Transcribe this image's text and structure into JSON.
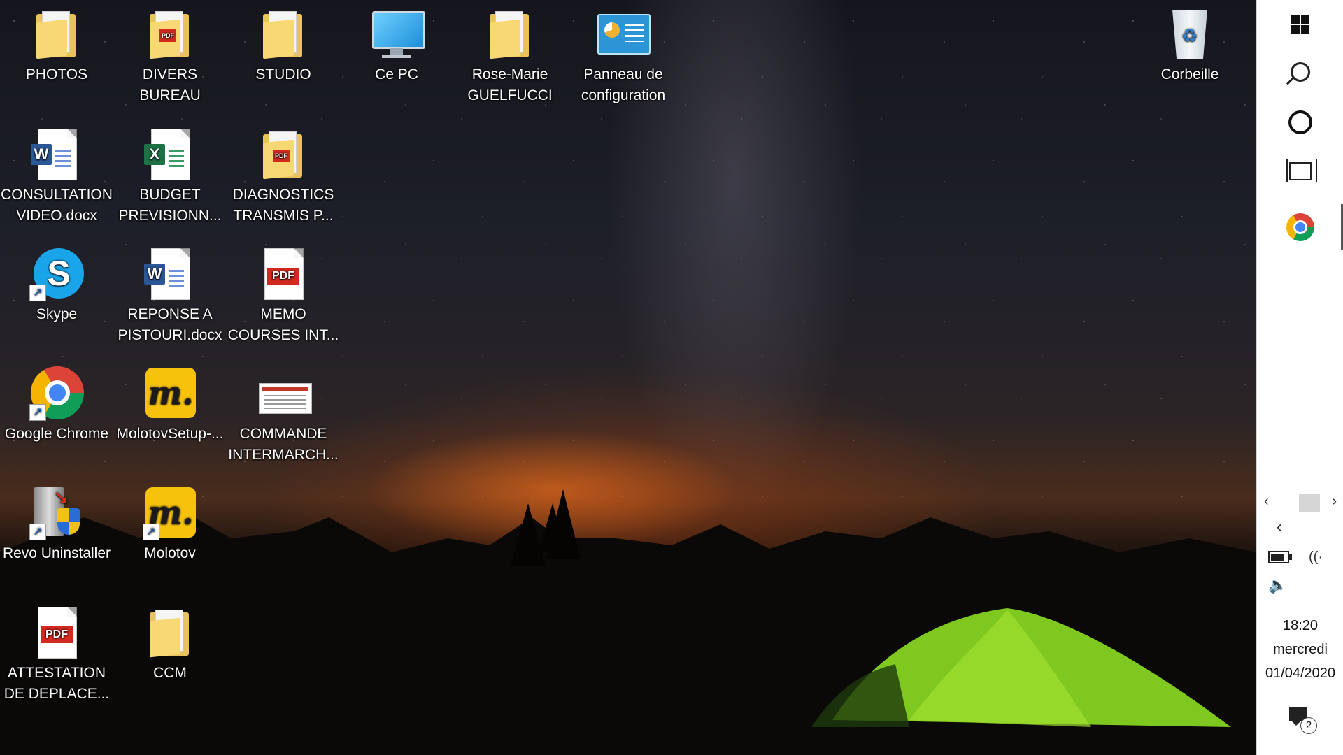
{
  "desktop": {
    "icons": [
      {
        "label": "PHOTOS",
        "kind": "folder"
      },
      {
        "label": "DIVERS BUREAU",
        "kind": "folder-pdf"
      },
      {
        "label": "STUDIO",
        "kind": "folder"
      },
      {
        "label": "Ce PC",
        "kind": "computer"
      },
      {
        "label": "Rose-Marie GUELFUCCI",
        "kind": "folder"
      },
      {
        "label": "Panneau de configuration",
        "kind": "control-panel"
      },
      {
        "label": "Corbeille",
        "kind": "recycle-bin"
      },
      {
        "label": "CONSULTATION VIDEO.docx",
        "kind": "word"
      },
      {
        "label": "BUDGET PREVISIONN...",
        "kind": "excel"
      },
      {
        "label": "DIAGNOSTICS TRANSMIS P...",
        "kind": "folder-pdf"
      },
      {
        "label": "Skype",
        "kind": "skype",
        "shortcut": true
      },
      {
        "label": "REPONSE A PISTOURI.docx",
        "kind": "word"
      },
      {
        "label": "MEMO COURSES INT...",
        "kind": "pdf"
      },
      {
        "label": "Google Chrome",
        "kind": "chrome",
        "shortcut": true
      },
      {
        "label": "MolotovSetup-...",
        "kind": "molotov"
      },
      {
        "label": "COMMANDE INTERMARCH...",
        "kind": "document"
      },
      {
        "label": "Revo Uninstaller",
        "kind": "revo",
        "shortcut": true
      },
      {
        "label": "Molotov",
        "kind": "molotov",
        "shortcut": true
      },
      {
        "label": "ATTESTATION DE DEPLACE...",
        "kind": "pdf"
      },
      {
        "label": "CCM",
        "kind": "folder"
      }
    ],
    "pdf_badge": "PDF",
    "word_badge": "W",
    "excel_badge": "X",
    "skype_badge": "S",
    "molotov_badge": "m."
  },
  "taskbar": {
    "start_icon": "windows-logo-icon",
    "search_icon": "search-icon",
    "cortana_icon": "cortana-icon",
    "taskview_icon": "task-view-icon",
    "pinned_app": "chrome-icon",
    "scroll_left": "‹",
    "scroll_right": "›",
    "tray_chevron": "‹",
    "tray_wifi": "((·",
    "tray_volume": "🔈",
    "time": "18:20",
    "day": "mercredi",
    "date": "01/04/2020",
    "notification_count": "2"
  }
}
